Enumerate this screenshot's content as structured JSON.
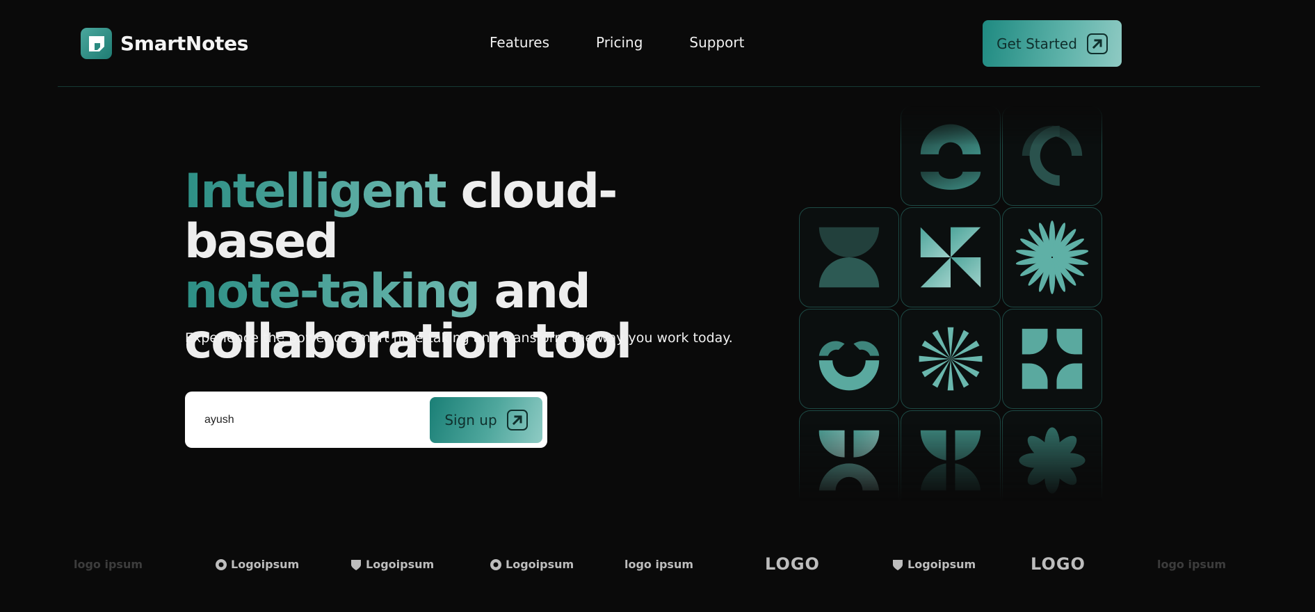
{
  "brand": {
    "name": "SmartNotes",
    "icon": "note-icon"
  },
  "nav": {
    "links": [
      "Features",
      "Pricing",
      "Support"
    ]
  },
  "cta": {
    "label": "Get Started",
    "icon": "arrow-up-right-icon"
  },
  "hero": {
    "title_accent_1": "Intelligent",
    "title_text_1": " cloud-based",
    "title_accent_2": "note-taking",
    "title_text_2": " and",
    "title_text_3": "collaboration tool",
    "subtitle": "Experience the power of smart note-taking and transform the way you work today."
  },
  "signup": {
    "value": "ayush",
    "button_label": "Sign up",
    "button_icon": "arrow-up-right-icon"
  },
  "logos": [
    "logo ipsum",
    "Logoipsum",
    "Logoipsum",
    "Logoipsum",
    "logo ipsum",
    "LOGO",
    "Logoipsum",
    "LOGO",
    "logo ipsum"
  ],
  "colors": {
    "background": "#0a0a0a",
    "accent": "#3a9b91",
    "accent_light": "#8fcac3",
    "tile_border": "#1d4a45"
  }
}
